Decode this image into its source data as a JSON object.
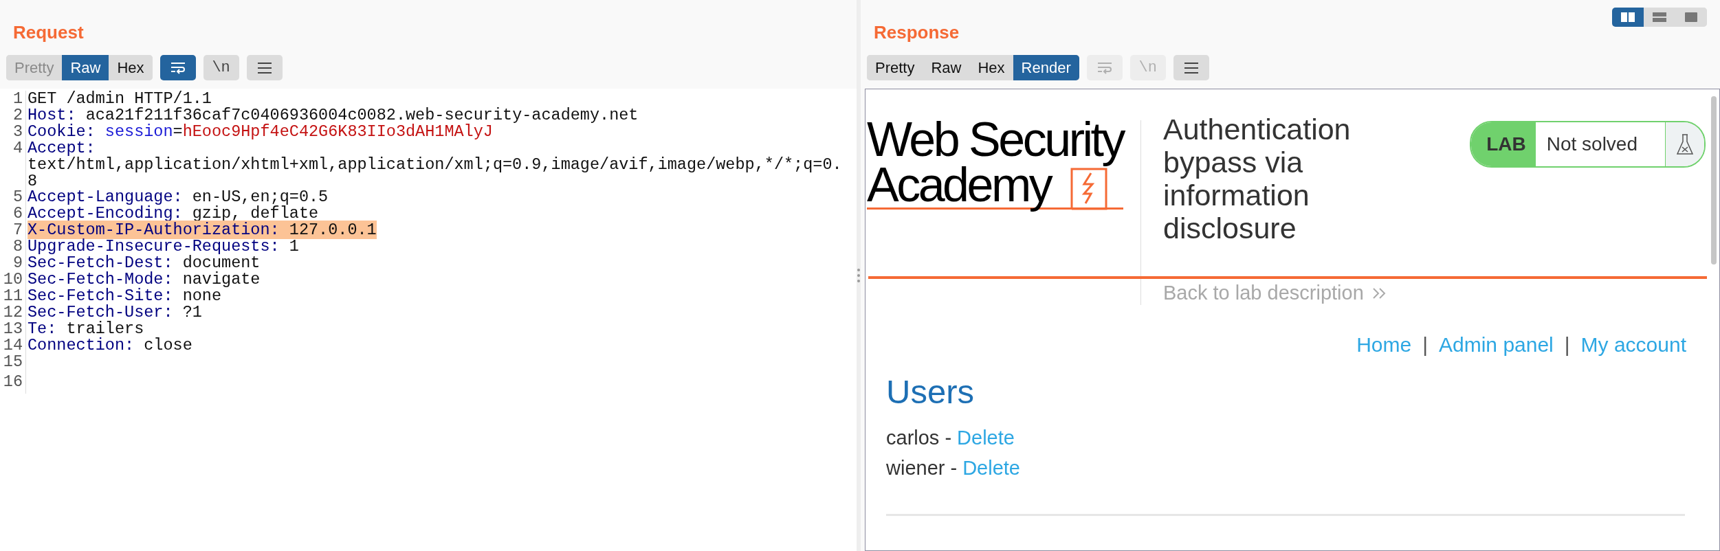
{
  "request": {
    "title": "Request",
    "view_tabs": [
      {
        "label": "Pretty",
        "selected": false,
        "disabled": true
      },
      {
        "label": "Raw",
        "selected": true,
        "disabled": false
      },
      {
        "label": "Hex",
        "selected": false,
        "disabled": false
      }
    ],
    "tools": [
      {
        "kind": "wrap",
        "selected": true,
        "disabled": false
      },
      {
        "kind": "newline",
        "text": "\\n",
        "selected": false,
        "disabled": false
      },
      {
        "kind": "menu",
        "selected": false,
        "disabled": false
      }
    ],
    "lines": [
      {
        "number": "1",
        "highlighted": false,
        "value": [
          {
            "kind": "text",
            "text": "GET /admin HTTP/1.1"
          }
        ]
      },
      {
        "number": "2",
        "highlighted": false,
        "name": "Host:",
        "value": [
          {
            "kind": "text",
            "text": "aca21f211f36caf7c0406936004c0082.web-security-academy.net"
          }
        ]
      },
      {
        "number": "3",
        "highlighted": false,
        "name": "Cookie:",
        "value": [
          {
            "kind": "param",
            "text": "session"
          },
          {
            "kind": "text",
            "text": "="
          },
          {
            "kind": "param-value",
            "text": "hEooc9Hpf4eC42G6K83IIo3dAH1MAlyJ"
          }
        ]
      },
      {
        "number": "4",
        "highlighted": false,
        "name": "Accept:",
        "value": [
          {
            "kind": "text",
            "text": "text/html,application/xhtml+xml,application/xml;q=0.9,image/avif,image/webp,*/*;q=0.8"
          }
        ]
      },
      {
        "number": "5",
        "highlighted": false,
        "name": "Accept-Language:",
        "value": [
          {
            "kind": "text",
            "text": "en-US,en;q=0.5"
          }
        ]
      },
      {
        "number": "6",
        "highlighted": false,
        "name": "Accept-Encoding:",
        "value": [
          {
            "kind": "text",
            "text": "gzip, deflate"
          }
        ]
      },
      {
        "number": "7",
        "highlighted": true,
        "name": "X-Custom-IP-Authorization:",
        "value": [
          {
            "kind": "text",
            "text": "127.0.0.1"
          }
        ]
      },
      {
        "number": "8",
        "highlighted": false,
        "name": "Upgrade-Insecure-Requests:",
        "value": [
          {
            "kind": "text",
            "text": "1"
          }
        ]
      },
      {
        "number": "9",
        "highlighted": false,
        "name": "Sec-Fetch-Dest:",
        "value": [
          {
            "kind": "text",
            "text": "document"
          }
        ]
      },
      {
        "number": "10",
        "highlighted": false,
        "name": "Sec-Fetch-Mode:",
        "value": [
          {
            "kind": "text",
            "text": "navigate"
          }
        ]
      },
      {
        "number": "11",
        "highlighted": false,
        "name": "Sec-Fetch-Site:",
        "value": [
          {
            "kind": "text",
            "text": "none"
          }
        ]
      },
      {
        "number": "12",
        "highlighted": false,
        "name": "Sec-Fetch-User:",
        "value": [
          {
            "kind": "text",
            "text": "?1"
          }
        ]
      },
      {
        "number": "13",
        "highlighted": false,
        "name": "Te:",
        "value": [
          {
            "kind": "text",
            "text": "trailers"
          }
        ]
      },
      {
        "number": "14",
        "highlighted": false,
        "name": "Connection:",
        "value": [
          {
            "kind": "text",
            "text": "close"
          }
        ]
      },
      {
        "number": "15",
        "highlighted": false
      },
      {
        "number": "16",
        "highlighted": false
      }
    ]
  },
  "response": {
    "title": "Response",
    "layout_options": [
      {
        "kind": "columns",
        "selected": true
      },
      {
        "kind": "rows",
        "selected": false
      },
      {
        "kind": "single",
        "selected": false
      }
    ],
    "view_tabs": [
      {
        "label": "Pretty",
        "selected": false,
        "disabled": false
      },
      {
        "label": "Raw",
        "selected": false,
        "disabled": false
      },
      {
        "label": "Hex",
        "selected": false,
        "disabled": false
      },
      {
        "label": "Render",
        "selected": true,
        "disabled": false
      }
    ],
    "tools": [
      {
        "kind": "wrap",
        "selected": false,
        "disabled": true
      },
      {
        "kind": "newline",
        "text": "\\n",
        "selected": false,
        "disabled": true
      },
      {
        "kind": "menu",
        "selected": false,
        "disabled": false
      }
    ],
    "render": {
      "logo": {
        "line_1": "Web Security",
        "line_2": "Academy"
      },
      "lab_title": "Authentication bypass via information disclosure",
      "lab_badge": {
        "label": "LAB",
        "status": "Not solved",
        "solved": false
      },
      "back_link": "Back to lab description",
      "nav": [
        {
          "kind": "link",
          "text": "Home"
        },
        {
          "kind": "separator",
          "text": "|"
        },
        {
          "kind": "link",
          "text": "Admin panel"
        },
        {
          "kind": "separator",
          "text": "|"
        },
        {
          "kind": "link",
          "text": "My account"
        }
      ],
      "heading": "Users",
      "users": [
        {
          "text": "carlos -",
          "action": "Delete"
        },
        {
          "text": "wiener -",
          "action": "Delete"
        }
      ]
    }
  }
}
